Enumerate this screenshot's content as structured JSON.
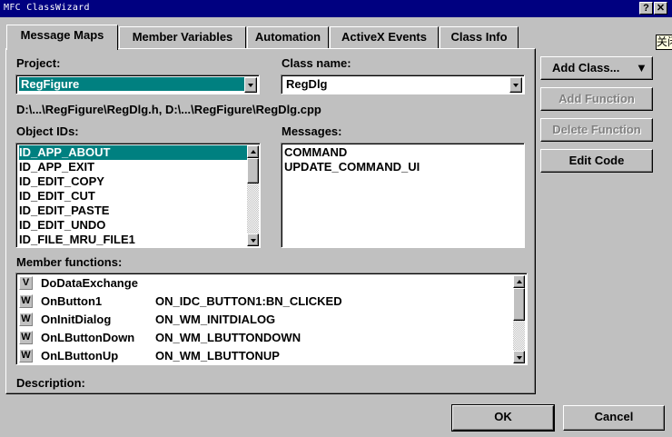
{
  "window": {
    "title": "MFC ClassWizard",
    "help_glyph": "?",
    "close_glyph": "✕"
  },
  "tabs": [
    {
      "label": "Message Maps",
      "active": true
    },
    {
      "label": "Member Variables",
      "active": false
    },
    {
      "label": "Automation",
      "active": false
    },
    {
      "label": "ActiveX Events",
      "active": false
    },
    {
      "label": "Class Info",
      "active": false
    }
  ],
  "corner_fragment": "关闭",
  "project": {
    "label": "Project:",
    "value": "RegFigure"
  },
  "class_name": {
    "label": "Class name:",
    "value": "RegDlg"
  },
  "file_path": "D:\\...\\RegFigure\\RegDlg.h, D:\\...\\RegFigure\\RegDlg.cpp",
  "object_ids": {
    "label": "Object IDs:",
    "items": [
      "ID_APP_ABOUT",
      "ID_APP_EXIT",
      "ID_EDIT_COPY",
      "ID_EDIT_CUT",
      "ID_EDIT_PASTE",
      "ID_EDIT_UNDO",
      "ID_FILE_MRU_FILE1"
    ]
  },
  "messages": {
    "label": "Messages:",
    "items": [
      "COMMAND",
      "UPDATE_COMMAND_UI"
    ]
  },
  "buttons": {
    "add_class": "Add Class...",
    "add_function": "Add Function",
    "delete_function": "Delete Function",
    "edit_code": "Edit Code",
    "ok": "OK",
    "cancel": "Cancel"
  },
  "member_functions": {
    "label": "Member functions:",
    "rows": [
      {
        "icon": "V",
        "name": "DoDataExchange",
        "map": ""
      },
      {
        "icon": "W",
        "name": "OnButton1",
        "map": "ON_IDC_BUTTON1:BN_CLICKED"
      },
      {
        "icon": "W",
        "name": "OnInitDialog",
        "map": "ON_WM_INITDIALOG"
      },
      {
        "icon": "W",
        "name": "OnLButtonDown",
        "map": "ON_WM_LBUTTONDOWN"
      },
      {
        "icon": "W",
        "name": "OnLButtonUp",
        "map": "ON_WM_LBUTTONUP"
      }
    ]
  },
  "description": {
    "label": "Description:"
  },
  "colors": {
    "title_bar": "#000080",
    "selection": "#008080",
    "face": "#c0c0c0"
  }
}
